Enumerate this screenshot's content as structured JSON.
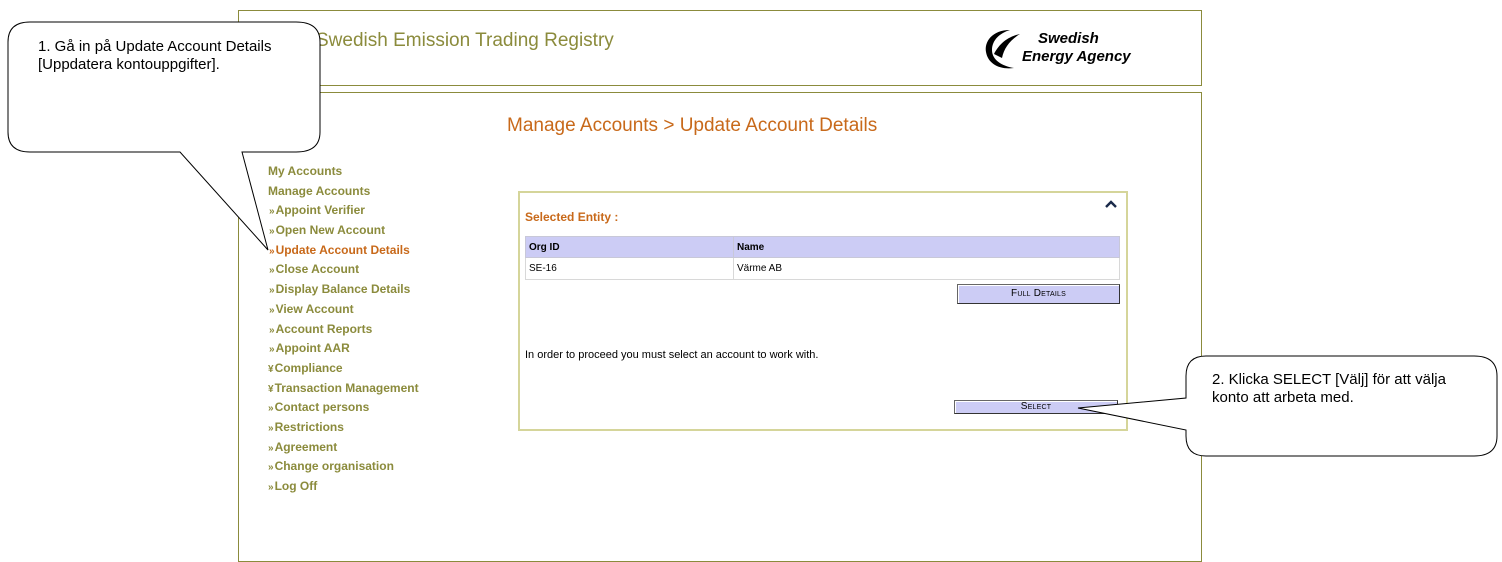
{
  "header": {
    "app_title": "Swedish Emission Trading Registry",
    "logo_line1": "Swedish",
    "logo_line2": "Energy Agency"
  },
  "page": {
    "heading": "Manage Accounts > Update Account Details"
  },
  "sidebar": {
    "items": [
      {
        "label": "My Accounts",
        "marker": "",
        "level": 0
      },
      {
        "label": "Manage Accounts",
        "marker": "",
        "level": 0
      },
      {
        "label": "Appoint Verifier",
        "marker": "»",
        "level": 1
      },
      {
        "label": "Open New Account",
        "marker": "»",
        "level": 1
      },
      {
        "label": "Update Account Details",
        "marker": "»",
        "level": 1,
        "active": true
      },
      {
        "label": "Close Account",
        "marker": "»",
        "level": 1
      },
      {
        "label": "Display Balance Details",
        "marker": "»",
        "level": 1
      },
      {
        "label": "View Account",
        "marker": "»",
        "level": 1
      },
      {
        "label": "Account Reports",
        "marker": "»",
        "level": 1
      },
      {
        "label": "Appoint AAR",
        "marker": "»",
        "level": 1
      },
      {
        "label": "Compliance",
        "marker": "¥",
        "level": 0
      },
      {
        "label": "Transaction Management",
        "marker": "¥",
        "level": 0
      },
      {
        "label": "Contact persons",
        "marker": "»",
        "level": 0
      },
      {
        "label": "Restrictions",
        "marker": "»",
        "level": 0
      },
      {
        "label": "Agreement",
        "marker": "»",
        "level": 0
      },
      {
        "label": "Change organisation",
        "marker": "»",
        "level": 0
      },
      {
        "label": "Log Off",
        "marker": "»",
        "level": 0
      }
    ]
  },
  "panel": {
    "selected_entity_label": "Selected Entity :",
    "columns": [
      "Org ID",
      "Name"
    ],
    "rows": [
      [
        "SE-16",
        "Värme AB"
      ]
    ],
    "full_details_label": "Full Details",
    "instruction": "In order to proceed you must select an account to work with.",
    "select_label": "Select"
  },
  "callouts": {
    "step1": "1. Gå in på Update Account Details [Uppdatera kontouppgifter].",
    "step2": "2. Klicka SELECT [Välj] för att välja konto att arbeta med."
  },
  "colors": {
    "frame_border": "#8b8b3c",
    "accent_orange": "#c8691a",
    "olive_text": "#8b8b3c",
    "table_header": "#ccccf5",
    "button_bg": "#ccccf5"
  }
}
